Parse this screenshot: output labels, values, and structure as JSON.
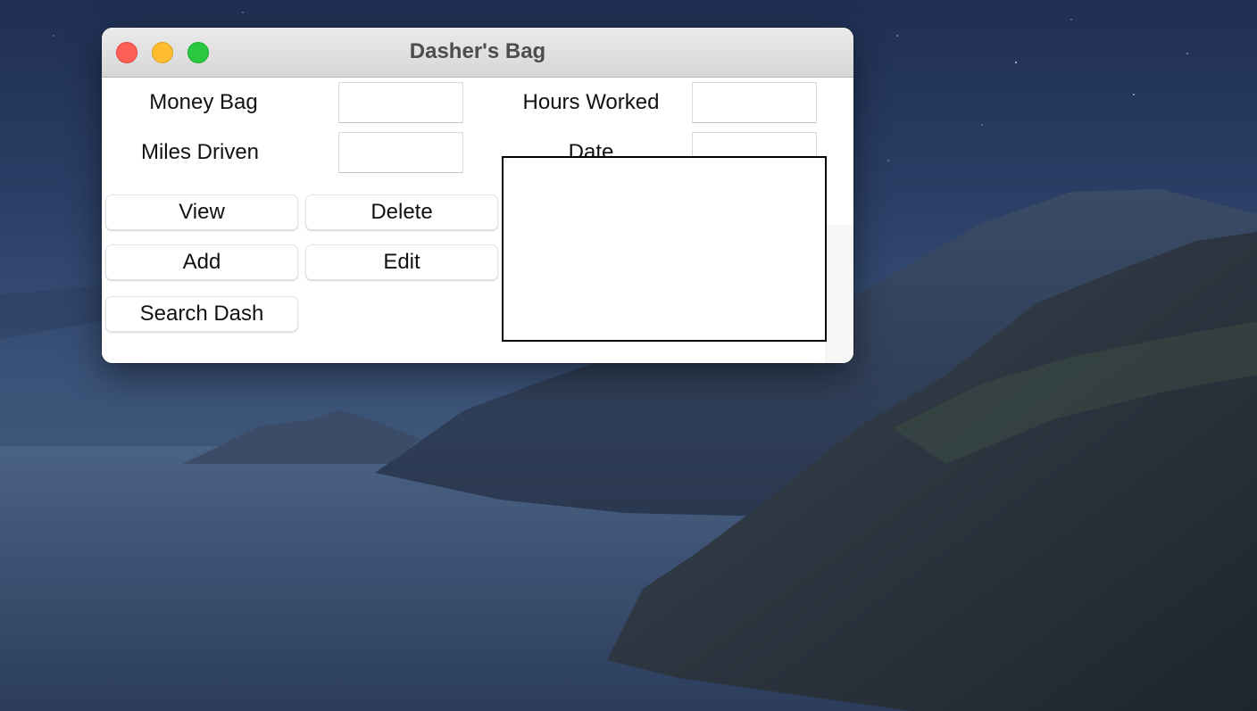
{
  "window": {
    "title": "Dasher's Bag"
  },
  "fields": {
    "money_bag": {
      "label": "Money Bag",
      "value": ""
    },
    "hours_worked": {
      "label": "Hours Worked",
      "value": ""
    },
    "miles_driven": {
      "label": "Miles Driven",
      "value": ""
    },
    "date": {
      "label": "Date",
      "value": ""
    }
  },
  "buttons": {
    "view": "View",
    "delete": "Delete",
    "add": "Add",
    "edit": "Edit",
    "search": "Search Dash"
  },
  "listbox": {
    "items": []
  },
  "colors": {
    "close": "#fe5f57",
    "minimize": "#febc2e",
    "maximize": "#28c840"
  }
}
